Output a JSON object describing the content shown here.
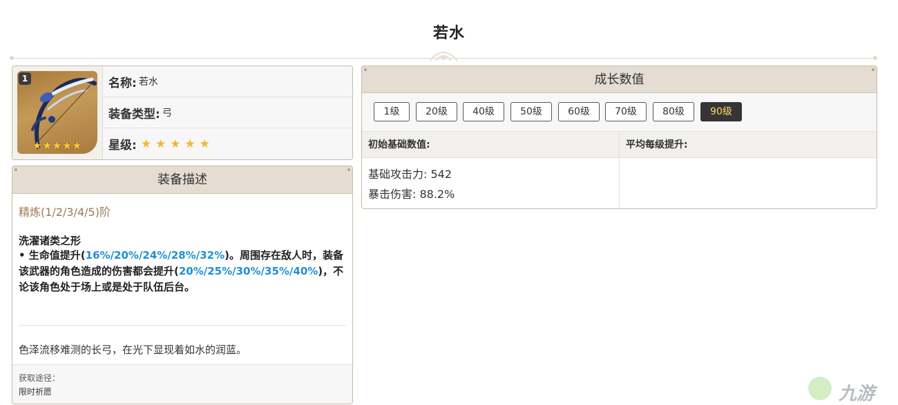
{
  "page": {
    "title": "若水"
  },
  "info": {
    "refine_badge": "1",
    "thumb_stars": "★★★★★",
    "name_label": "名称:",
    "name_value": "若水",
    "type_label": "装备类型:",
    "type_value": "弓",
    "rarity_label": "星级:",
    "rarity_stars": "★★★★★",
    "rarity_count": 5
  },
  "description": {
    "header": "装备描述",
    "refine_line": "精炼(1/2/3/4/5)阶",
    "passive_name": "洗濯诸类之形",
    "passive_parts": [
      {
        "text": "• 生命值提升(",
        "hl": false
      },
      {
        "text": "16%/20%/24%/28%/32%",
        "hl": true
      },
      {
        "text": ")。周围存在敌人时，装备该武器的角色造成的伤害都会提升(",
        "hl": false
      },
      {
        "text": "20%/25%/30%/35%/40%",
        "hl": true
      },
      {
        "text": ")，不论该角色处于场上或是处于队伍后台。",
        "hl": false
      }
    ],
    "flavor": "色泽流移难测的长弓，在光下显现着如水的润蓝。",
    "source_label": "获取途径：",
    "source_value": "限时祈愿"
  },
  "growth": {
    "header": "成长数值",
    "levels": [
      "1级",
      "20级",
      "40级",
      "50级",
      "60级",
      "70级",
      "80级",
      "90级"
    ],
    "active_level": "90级",
    "col_base": "初始基础数值:",
    "col_avg": "平均每级提升:",
    "base_stats": [
      "基础攻击力: 542",
      "暴击伤害: 88.2%"
    ]
  },
  "colors": {
    "accent_blue": "#1e8fd6",
    "header_bg": "#e5ddd2",
    "border": "#c8b9a6",
    "active_level_bg": "#353535",
    "active_level_text": "#ffd76b",
    "star": "#f5b82a"
  },
  "watermark": {
    "text": "九游"
  }
}
